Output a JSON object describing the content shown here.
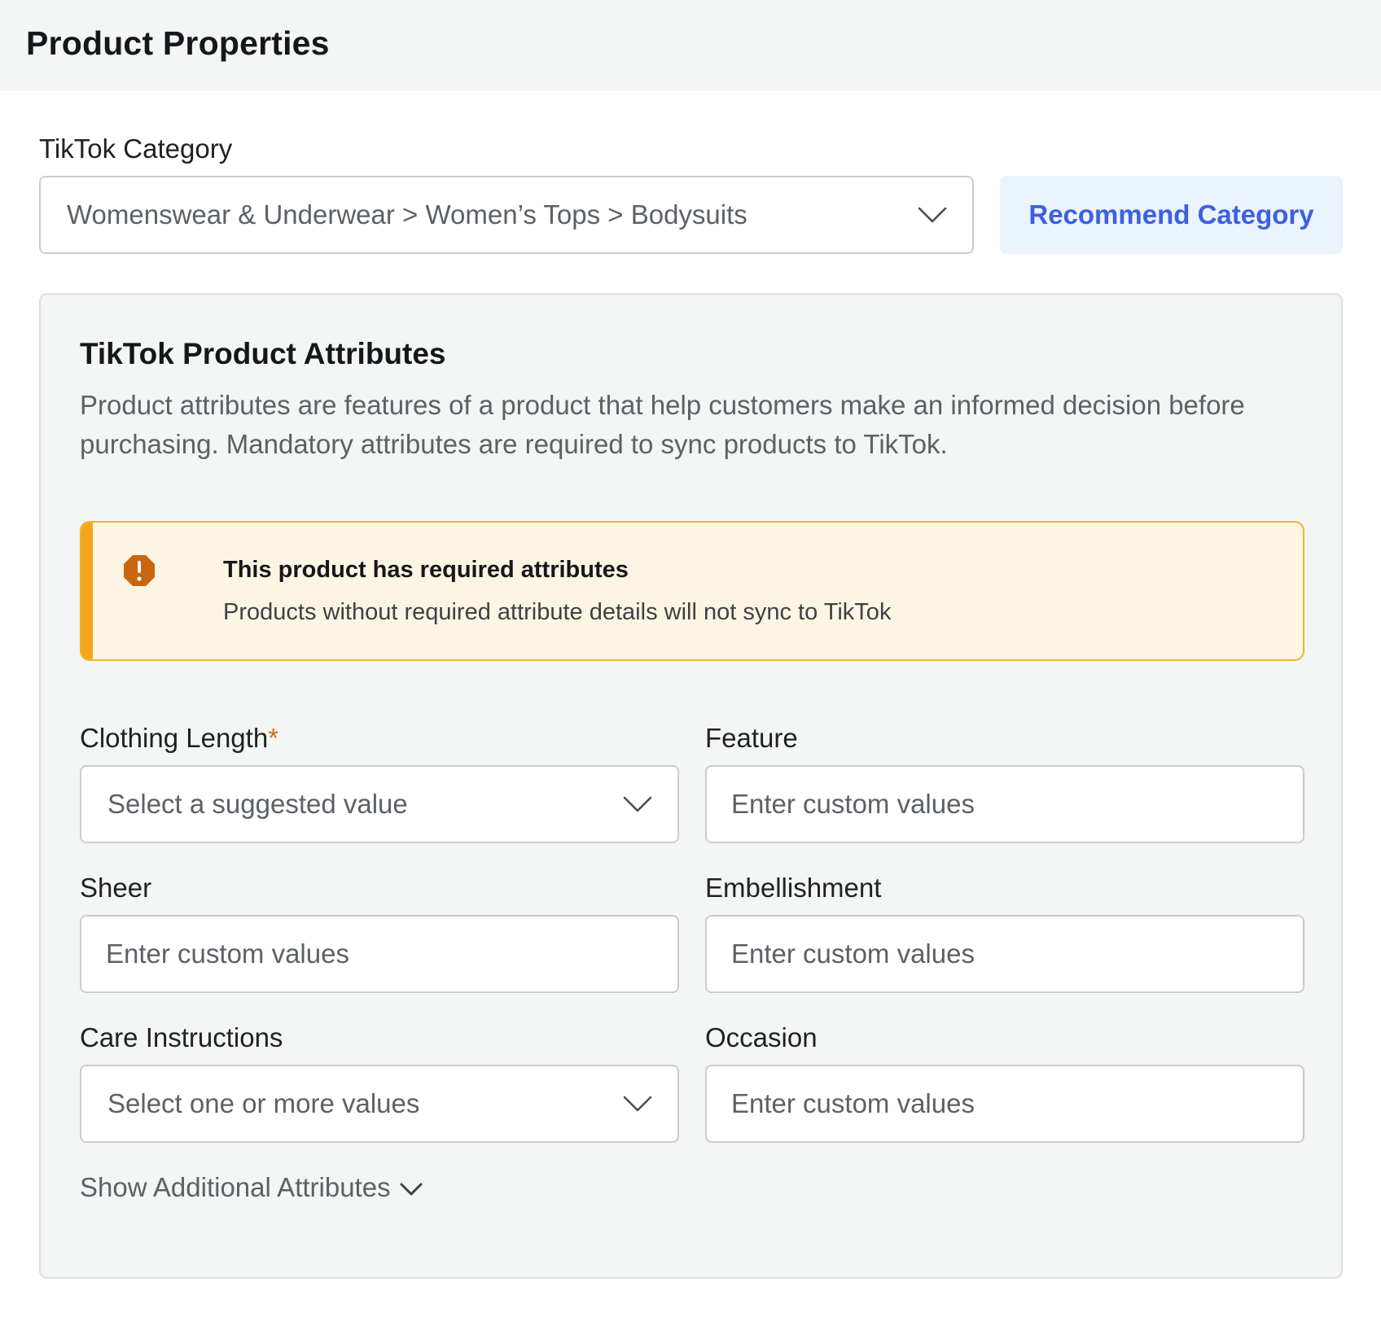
{
  "header": {
    "title": "Product Properties"
  },
  "category": {
    "label": "TikTok Category",
    "selected": "Womenswear & Underwear > Women’s Tops > Bodysuits",
    "recommend_label": "Recommend Category"
  },
  "attributes": {
    "title": "TikTok Product Attributes",
    "description": "Product attributes are features of a product that help customers make an informed decision before purchasing. Mandatory attributes are required to sync products to TikTok.",
    "alert": {
      "title": "This product has required attributes",
      "text": "Products without required attribute details will not sync to TikTok"
    },
    "fields": {
      "clothing_length": {
        "label": "Clothing Length",
        "required_mark": "*",
        "placeholder": "Select a suggested value"
      },
      "feature": {
        "label": "Feature",
        "placeholder": "Enter custom values"
      },
      "sheer": {
        "label": "Sheer",
        "placeholder": "Enter custom values"
      },
      "embellishment": {
        "label": "Embellishment",
        "placeholder": "Enter custom values"
      },
      "care_instructions": {
        "label": "Care Instructions",
        "placeholder": "Select one or more values"
      },
      "occasion": {
        "label": "Occasion",
        "placeholder": "Enter custom values"
      }
    },
    "show_more_label": "Show Additional Attributes"
  },
  "colors": {
    "accent": "#3c60e0",
    "warning": "#f2a81d",
    "warning_bg": "#fdf5e4",
    "required": "#d26b16"
  },
  "icons": [
    "chevron-down-icon",
    "warning-icon"
  ]
}
